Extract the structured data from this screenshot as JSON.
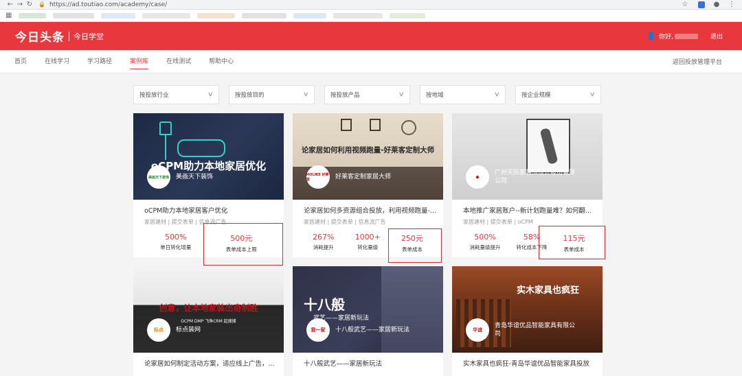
{
  "browser": {
    "url": "https://ad.toutiao.com/academy/case/"
  },
  "header": {
    "logo": "今日头条",
    "subtitle": "今日学堂",
    "greeting": "你好,",
    "logout": "退出"
  },
  "nav": {
    "items": [
      {
        "label": "首页",
        "active": false
      },
      {
        "label": "在线学习",
        "active": false
      },
      {
        "label": "学习路径",
        "active": false
      },
      {
        "label": "案例库",
        "active": true
      },
      {
        "label": "在线测试",
        "active": false
      },
      {
        "label": "帮助中心",
        "active": false
      }
    ],
    "back": "返回投放管理平台"
  },
  "filters": [
    {
      "label": "按投放行业"
    },
    {
      "label": "按投放目的"
    },
    {
      "label": "按投放产品"
    },
    {
      "label": "按地域"
    },
    {
      "label": "按企业规模"
    }
  ],
  "cards": [
    {
      "headline": "oCPM助力本地家居优化",
      "brand_logo": "美画天下装饰",
      "brand": "美画天下装饰",
      "title": "oCPM助力本地家居客户优化",
      "tags": "家居建材 | 提交表单 | 信息流广告",
      "metrics": [
        {
          "value": "500%",
          "label": "单日转化增量"
        },
        {
          "value": "500元",
          "label": "表单成本上限"
        }
      ]
    },
    {
      "headline": "论家居如何利用视频跑量-好莱客定制大师",
      "brand_logo": "HOLIKE 好莱客",
      "brand": "好莱客定制家居大师",
      "title": "论家居如何多资源组合投放，利用视频跑量-...",
      "tags": "家居建材 | 提交表单 | 信息流广告",
      "metrics": [
        {
          "value": "267%",
          "label": "消耗提升"
        },
        {
          "value": "1000+",
          "label": "转化量级"
        },
        {
          "value": "250元",
          "label": "表单成本"
        }
      ]
    },
    {
      "headline": "",
      "brand_logo": "",
      "brand": "广州天际家装饰设计股份有限公司",
      "title": "本地推广家居账户--新计划跑量难？如何翻...",
      "tags": "家居建材 | 提交表单 | oCPM",
      "metrics": [
        {
          "value": "500%",
          "label": "消耗量级提升"
        },
        {
          "value": "58%",
          "label": "转化成本下降"
        },
        {
          "value": "115元",
          "label": "表单成本"
        }
      ]
    },
    {
      "headline": "创意，让本地家装出奇制胜",
      "sub": "OCPM  DMP  飞鱼CRM  起搜搜",
      "brand_logo": "标点",
      "brand": "标点装网",
      "title": "论家居如何制定活动方案，适应线上广告，...",
      "tags": "",
      "metrics": []
    },
    {
      "headline": "十八般",
      "sub": "武艺——家居新玩法",
      "brand_logo": "我一家",
      "brand": "十八般武艺——家居新玩法",
      "title": "十八般武艺——家居新玩法",
      "tags": "",
      "metrics": []
    },
    {
      "headline": "实木家具也疯狂",
      "brand_logo": "华谊",
      "brand": "青岛华谊优品智能家具有限公司",
      "title": "实木家具也疯狂-青岛华谊优品智能家具投放",
      "tags": "",
      "metrics": []
    }
  ],
  "colors": {
    "brand_red": "#e8383d",
    "highlight_box": "#d62b30"
  }
}
